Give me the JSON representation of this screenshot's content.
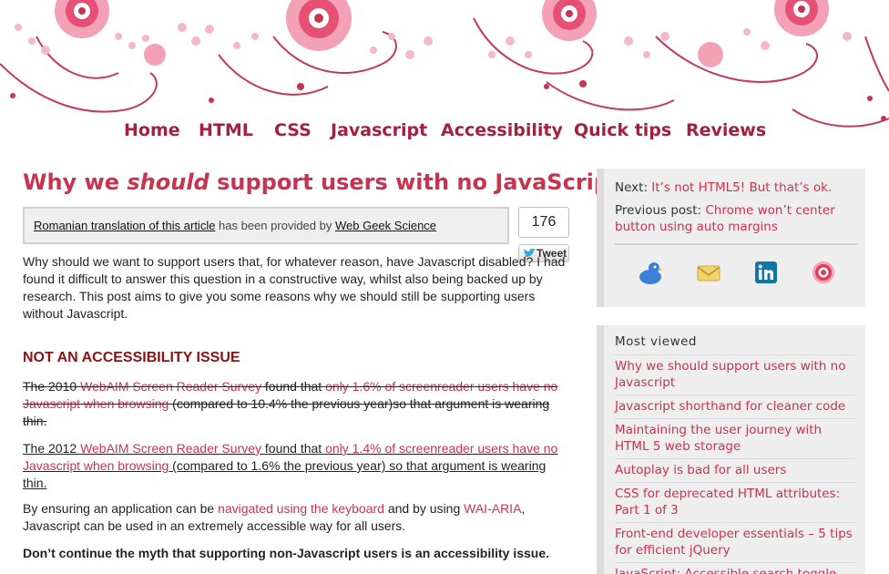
{
  "nav": {
    "items": [
      "Home",
      "HTML",
      "CSS",
      "Javascript",
      "Accessibility",
      "Quick tips",
      "Reviews"
    ]
  },
  "post": {
    "title_before": "Why we ",
    "title_em": "should",
    "title_after": " support users with no JavaScript",
    "translation_link": "Romanian translation of this article",
    "translation_mid": " has been provided by ",
    "translation_provider": "Web Geek Science",
    "tweet_count": "176",
    "tweet_label": "Tweet",
    "intro": "Why should we want to support users that, for whatever reason, have Javascript disabled? I had found it difficult to answer this question in a constructive way, whilst also being backed up by research. This post aims to give you some reasons why we should still be supporting users without Javascript.",
    "heading": "NOT AN ACCESSIBILITY ISSUE",
    "p2010": {
      "t1": "The 2010 ",
      "link1": "WebAIM Screen Reader Survey",
      "t2": " found that ",
      "link2": "only 1.6% of screenreader users have no Javascript when browsing",
      "t3": " (compared to 10.4% the previous year)so that argument is wearing thin."
    },
    "p2012": {
      "t1": "The 2012 ",
      "link1": "WebAIM Screen Reader Survey",
      "t2": " found that ",
      "link2": "only 1.4% of screenreader users have no Javascript when browsing",
      "t3": " (compared to 1.6% the previous year) so that argument is wearing thin."
    },
    "p_keyboard": {
      "t1": "By ensuring an application can be ",
      "link1": "navigated using the keyboard",
      "t2": " and by using ",
      "link2": "WAI-ARIA",
      "t3": ", Javascript can be used in an extremely accessible way for all users."
    },
    "myth": "Don’t continue the myth that supporting non-Javascript users is an accessibility issue."
  },
  "sidebar": {
    "next_label": "Next: ",
    "next_link": "It’s not HTML5! But that’s ok.",
    "prev_label": "Previous post: ",
    "prev_link": "Chrome won’t center button using auto margins",
    "social_icons": [
      "delicious-duck-icon",
      "email-icon",
      "linkedin-icon",
      "target-icon"
    ],
    "most_viewed_title": "Most viewed",
    "most_viewed": [
      "Why we should support users with no Javascript",
      "Javascript shorthand for cleaner code",
      "Maintaining the user journey with HTML 5 web storage",
      "Autoplay is bad for all users",
      "CSS for deprecated HTML attributes: Part 1 of 3",
      "Front-end developer essentials – 5 tips for efficient jQuery",
      "JavaScript: Accessible search toggle"
    ]
  },
  "colors": {
    "accent": "#c8334f",
    "nav": "#a3203f",
    "heading": "#8b1212"
  }
}
